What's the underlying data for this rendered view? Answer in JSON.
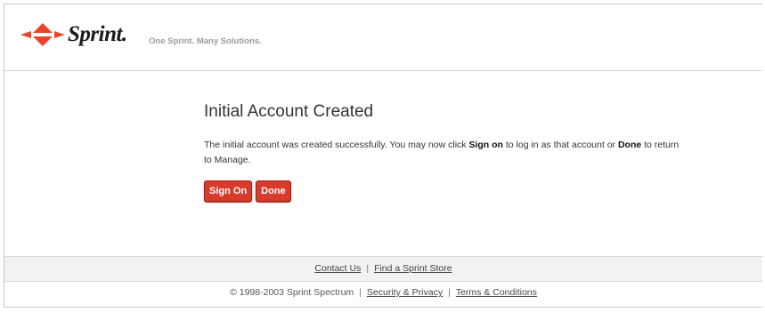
{
  "header": {
    "brand": "Sprint.",
    "tagline": "One Sprint. Many Solutions.",
    "logo_icon": "sprint-diamond-icon",
    "logo_color": "#e8452c"
  },
  "main": {
    "title": "Initial Account Created",
    "message_part1": "The initial account was created successfully.  You may now click ",
    "sign_on_bold": "Sign on",
    "message_part2": " to log in as that account or ",
    "done_bold": "Done",
    "message_part3": " to return to Manage.",
    "sign_on_button": "Sign On",
    "done_button": "Done",
    "button_color": "#d83a2b"
  },
  "footer": {
    "contact_us": "Contact Us",
    "separator": "|",
    "find_store": "Find a Sprint Store",
    "copyright": "© 1998-2003 Sprint Spectrum",
    "security_privacy": "Security & Privacy",
    "terms": "Terms & Conditions"
  }
}
